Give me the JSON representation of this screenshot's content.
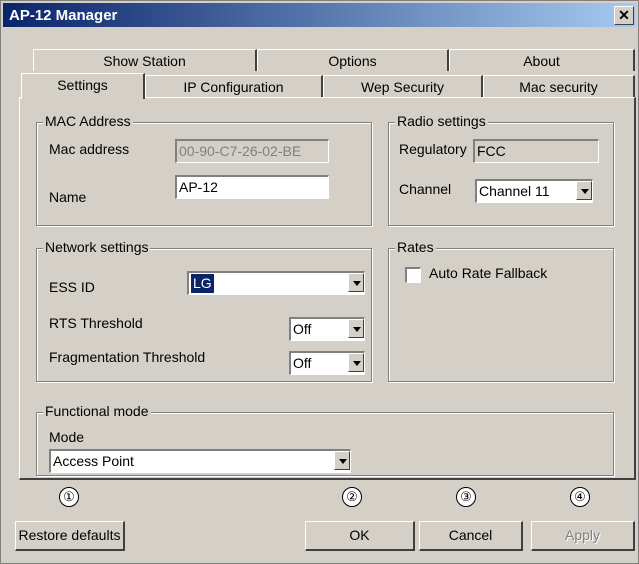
{
  "window": {
    "title": "AP-12 Manager",
    "close_glyph": "✕"
  },
  "tabs": {
    "back_row": [
      "Show Station",
      "Options",
      "About"
    ],
    "front_row": [
      "Settings",
      "IP Configuration",
      "Wep Security",
      "Mac security"
    ],
    "active": "Settings"
  },
  "mac": {
    "legend": "MAC Address",
    "mac_label": "Mac address",
    "mac_value": "00-90-C7-26-02-BE",
    "name_label": "Name",
    "name_value": "AP-12"
  },
  "radio": {
    "legend": "Radio settings",
    "regulatory_label": "Regulatory",
    "regulatory_value": "FCC",
    "channel_label": "Channel",
    "channel_value": "Channel 11"
  },
  "network": {
    "legend": "Network settings",
    "essid_label": "ESS ID",
    "essid_value": "LG",
    "rts_label": "RTS Threshold",
    "rts_value": "Off",
    "frag_label": "Fragmentation Threshold",
    "frag_value": "Off"
  },
  "rates": {
    "legend": "Rates",
    "auto_rate_label": "Auto Rate Fallback",
    "auto_rate_checked": false
  },
  "functional": {
    "legend": "Functional mode",
    "mode_label": "Mode",
    "mode_value": "Access Point"
  },
  "markers": [
    "①",
    "②",
    "③",
    "④"
  ],
  "buttons": {
    "restore": "Restore defaults",
    "ok": "OK",
    "cancel": "Cancel",
    "apply": "Apply"
  }
}
